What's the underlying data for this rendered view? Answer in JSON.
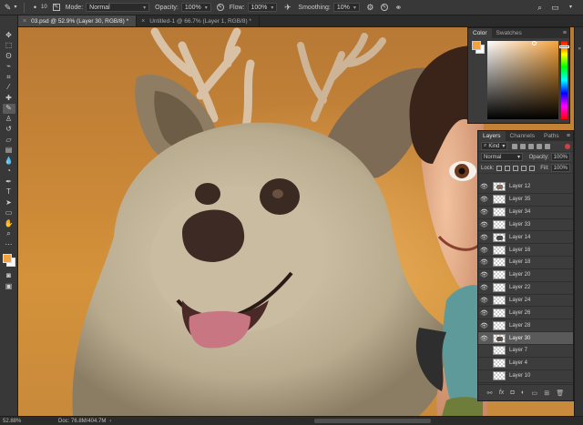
{
  "options_bar": {
    "brush_size": "10",
    "mode_label": "Mode:",
    "mode_value": "Normal",
    "opacity_label": "Opacity:",
    "opacity_value": "100%",
    "flow_label": "Flow:",
    "flow_value": "100%",
    "smoothing_label": "Smoothing:",
    "smoothing_value": "10%"
  },
  "tabs": [
    {
      "title": "03.psd @ 52.9% (Layer 30, RGB/8) *"
    },
    {
      "title": "Untitled-1 @ 66.7% (Layer 1, RGB/8) *"
    }
  ],
  "color_panel": {
    "tabs": [
      "Color",
      "Swatches"
    ],
    "foreground": "#f2a33d",
    "background": "#f7f7f7"
  },
  "layers_panel": {
    "tabs": [
      "Layers",
      "Channels",
      "Paths"
    ],
    "filter_kind": "Kind",
    "blend_mode": "Normal",
    "opacity_label": "Opacity:",
    "opacity_value": "100%",
    "lock_label": "Lock:",
    "fill_label": "Fill:",
    "fill_value": "100%",
    "layers": [
      {
        "name": "Layer 12",
        "visible": true,
        "selected": false
      },
      {
        "name": "Layer 35",
        "visible": true,
        "selected": false
      },
      {
        "name": "Layer 34",
        "visible": true,
        "selected": false
      },
      {
        "name": "Layer 33",
        "visible": true,
        "selected": false
      },
      {
        "name": "Layer 14",
        "visible": true,
        "selected": false
      },
      {
        "name": "Layer 16",
        "visible": true,
        "selected": false
      },
      {
        "name": "Layer 18",
        "visible": true,
        "selected": false
      },
      {
        "name": "Layer 20",
        "visible": true,
        "selected": false
      },
      {
        "name": "Layer 22",
        "visible": true,
        "selected": false
      },
      {
        "name": "Layer 24",
        "visible": true,
        "selected": false
      },
      {
        "name": "Layer 26",
        "visible": true,
        "selected": false
      },
      {
        "name": "Layer 28",
        "visible": true,
        "selected": false
      },
      {
        "name": "Layer 30",
        "visible": true,
        "selected": true
      },
      {
        "name": "Layer 7",
        "visible": false,
        "selected": false
      },
      {
        "name": "Layer 4",
        "visible": false,
        "selected": false
      },
      {
        "name": "Layer 10",
        "visible": false,
        "selected": false
      }
    ]
  },
  "status_bar": {
    "zoom": "52.88%",
    "doc": "Doc: 76.8M/404.7M"
  },
  "colors": {
    "ui_dark": "#383838",
    "panel": "#3c3c3c",
    "canvas_bg": "#c98838",
    "selected_row": "#5a5a5a"
  },
  "icons": {
    "tools": [
      "move-icon",
      "marquee-icon",
      "lasso-icon",
      "quick-select-icon",
      "crop-icon",
      "eyedropper-icon",
      "healing-icon",
      "brush-icon",
      "stamp-icon",
      "history-brush-icon",
      "eraser-icon",
      "gradient-icon",
      "blur-icon",
      "dodge-icon",
      "pen-icon",
      "type-icon",
      "path-select-icon",
      "shape-icon",
      "hand-icon",
      "zoom-icon"
    ]
  }
}
